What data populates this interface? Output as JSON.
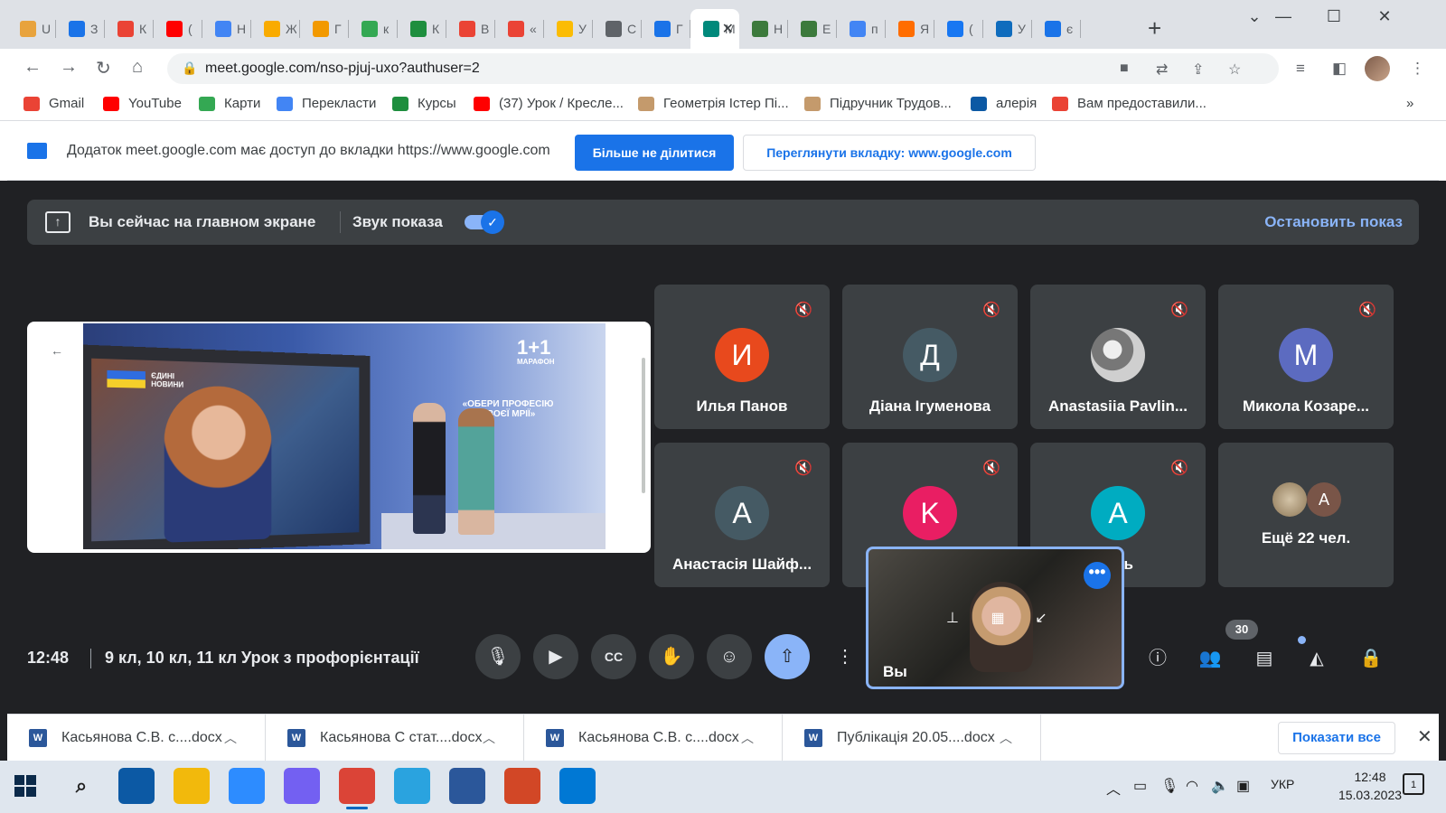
{
  "browser": {
    "tabs": [
      {
        "title": "U",
        "icon": "word-icon",
        "color": "#e8a33d"
      },
      {
        "title": "З",
        "icon": "contacts-icon",
        "color": "#1a73e8"
      },
      {
        "title": "К",
        "icon": "google-icon",
        "color": "#ea4335"
      },
      {
        "title": "(",
        "icon": "youtube-icon",
        "color": "#ff0000"
      },
      {
        "title": "Н",
        "icon": "google-icon",
        "color": "#4285f4"
      },
      {
        "title": "Ж",
        "icon": "sun-icon",
        "color": "#f9ab00"
      },
      {
        "title": "Г",
        "icon": "bell-icon",
        "color": "#f29900"
      },
      {
        "title": "к",
        "icon": "google-icon",
        "color": "#34a853"
      },
      {
        "title": "К",
        "icon": "classroom-icon",
        "color": "#1e8e3e"
      },
      {
        "title": "В",
        "icon": "gmail-icon",
        "color": "#ea4335"
      },
      {
        "title": "«",
        "icon": "gmail-icon",
        "color": "#ea4335"
      },
      {
        "title": "У",
        "icon": "drive-icon",
        "color": "#fbbc04"
      },
      {
        "title": "С",
        "icon": "globe-icon",
        "color": "#5f6368"
      },
      {
        "title": "Г",
        "icon": "calendar-icon",
        "color": "#1a73e8"
      },
      {
        "title": "М",
        "icon": "meet-icon",
        "color": "#00897b",
        "active": true
      },
      {
        "title": "Н",
        "icon": "gear-icon",
        "color": "#3c7a3c"
      },
      {
        "title": "Е",
        "icon": "gear-icon",
        "color": "#3c7a3c"
      },
      {
        "title": "п",
        "icon": "google-icon",
        "color": "#4285f4"
      },
      {
        "title": "Я",
        "icon": "ictv-icon",
        "color": "#ff6d00"
      },
      {
        "title": "(",
        "icon": "facebook-icon",
        "color": "#1877f2"
      },
      {
        "title": "У",
        "icon": "outlook-icon",
        "color": "#0f6cbd"
      },
      {
        "title": "є",
        "icon": "monitor-icon",
        "color": "#1a73e8"
      }
    ],
    "new_tab_label": "+",
    "window_controls": {
      "dropdown": "⌄",
      "minimize": "—",
      "maximize": "☐",
      "close": "✕"
    },
    "url": "meet.google.com/nso-pjuj-uxo?authuser=2",
    "bookmarks": [
      {
        "label": "Gmail",
        "icon": "gmail-icon",
        "color": "#ea4335"
      },
      {
        "label": "YouTube",
        "icon": "youtube-icon",
        "color": "#ff0000"
      },
      {
        "label": "Карти",
        "icon": "maps-icon",
        "color": "#34a853"
      },
      {
        "label": "Перекласти",
        "icon": "translate-icon",
        "color": "#4285f4"
      },
      {
        "label": "Курсы",
        "icon": "classroom-icon",
        "color": "#1e8e3e"
      },
      {
        "label": "(37) Урок / Кресле...",
        "icon": "youtube-icon",
        "color": "#ff0000"
      },
      {
        "label": "Геометрія Істер Пі...",
        "icon": "book-icon",
        "color": "#c49a6c"
      },
      {
        "label": "Підручник Трудов...",
        "icon": "book-icon",
        "color": "#c49a6c"
      },
      {
        "label": "алерія",
        "icon": "edge-icon",
        "color": "#0c59a4"
      },
      {
        "label": "Вам предоставили...",
        "icon": "gmail-icon",
        "color": "#ea4335"
      }
    ],
    "bookmarks_more": "»"
  },
  "infobar": {
    "message": "Додаток meet.google.com має доступ до вкладки https://www.google.com",
    "stop_sharing_label": "Більше не ділитися",
    "view_tab_label": "Переглянути вкладку: www.google.com"
  },
  "presenting": {
    "text": "Вы сейчас на главном экране",
    "audio_label": "Звук показа",
    "audio_on": true,
    "stop_label": "Остановить показ"
  },
  "slide": {
    "news_text": "ЄДИНІ НОВИНИ",
    "channel_logo": "1+1",
    "channel_sub": "МАРАФОН",
    "slogan": "«ОБЕРИ ПРОФЕСІЮ СВОЄЇ МРІЇ»"
  },
  "participants": [
    {
      "name": "Илья Панов",
      "initial": "И",
      "color": "#e8491d",
      "muted": true
    },
    {
      "name": "Діана Ігуменова",
      "initial": "Д",
      "color": "#455a64",
      "muted": true
    },
    {
      "name": "Anastasiia Pavlin...",
      "initial": "",
      "color": "#9e9e9e",
      "muted": true,
      "photo": true
    },
    {
      "name": "Микола Козаре...",
      "initial": "M",
      "color": "#5c6bc0",
      "muted": true
    },
    {
      "name": "Анастасія Шайф...",
      "initial": "A",
      "color": "#455a64",
      "muted": true
    },
    {
      "name": "",
      "initial": "K",
      "color": "#e91e63",
      "muted": true
    },
    {
      "name": "ель",
      "initial": "A",
      "color": "#00acc1",
      "muted": true
    }
  ],
  "more_participants": {
    "label": "Ещё 22 чел.",
    "avatar_initial": "A",
    "avatar_color": "#795548"
  },
  "self_view": {
    "label": "Вы"
  },
  "bottom_bar": {
    "time": "12:48",
    "meeting_title": "9 кл, 10 кл, 11 кл Урок з профорієнтації",
    "participant_count": "30"
  },
  "downloads": [
    {
      "name": "Касьянова С.В. с....docx"
    },
    {
      "name": "Касьянова С стат....docx"
    },
    {
      "name": "Касьянова С.В. с....docx"
    },
    {
      "name": "Публікація 20.05....docx"
    }
  ],
  "downloads_show_all": "Показати все",
  "taskbar": {
    "language": "УКР",
    "time": "12:48",
    "date": "15.03.2023",
    "notification_count": "1",
    "apps": [
      {
        "name": "search-icon",
        "color": "#dfe6ee"
      },
      {
        "name": "edge-icon",
        "color": "#0c59a4"
      },
      {
        "name": "folder-icon",
        "color": "#f2b90c"
      },
      {
        "name": "zoom-icon",
        "color": "#2d8cff"
      },
      {
        "name": "viber-icon",
        "color": "#7360f2"
      },
      {
        "name": "chrome-icon",
        "color": "#db4437"
      },
      {
        "name": "telegram-icon",
        "color": "#2aa3df"
      },
      {
        "name": "word-icon",
        "color": "#2b579a"
      },
      {
        "name": "powerpoint-icon",
        "color": "#d24726"
      },
      {
        "name": "photos-icon",
        "color": "#0078d4"
      }
    ]
  }
}
